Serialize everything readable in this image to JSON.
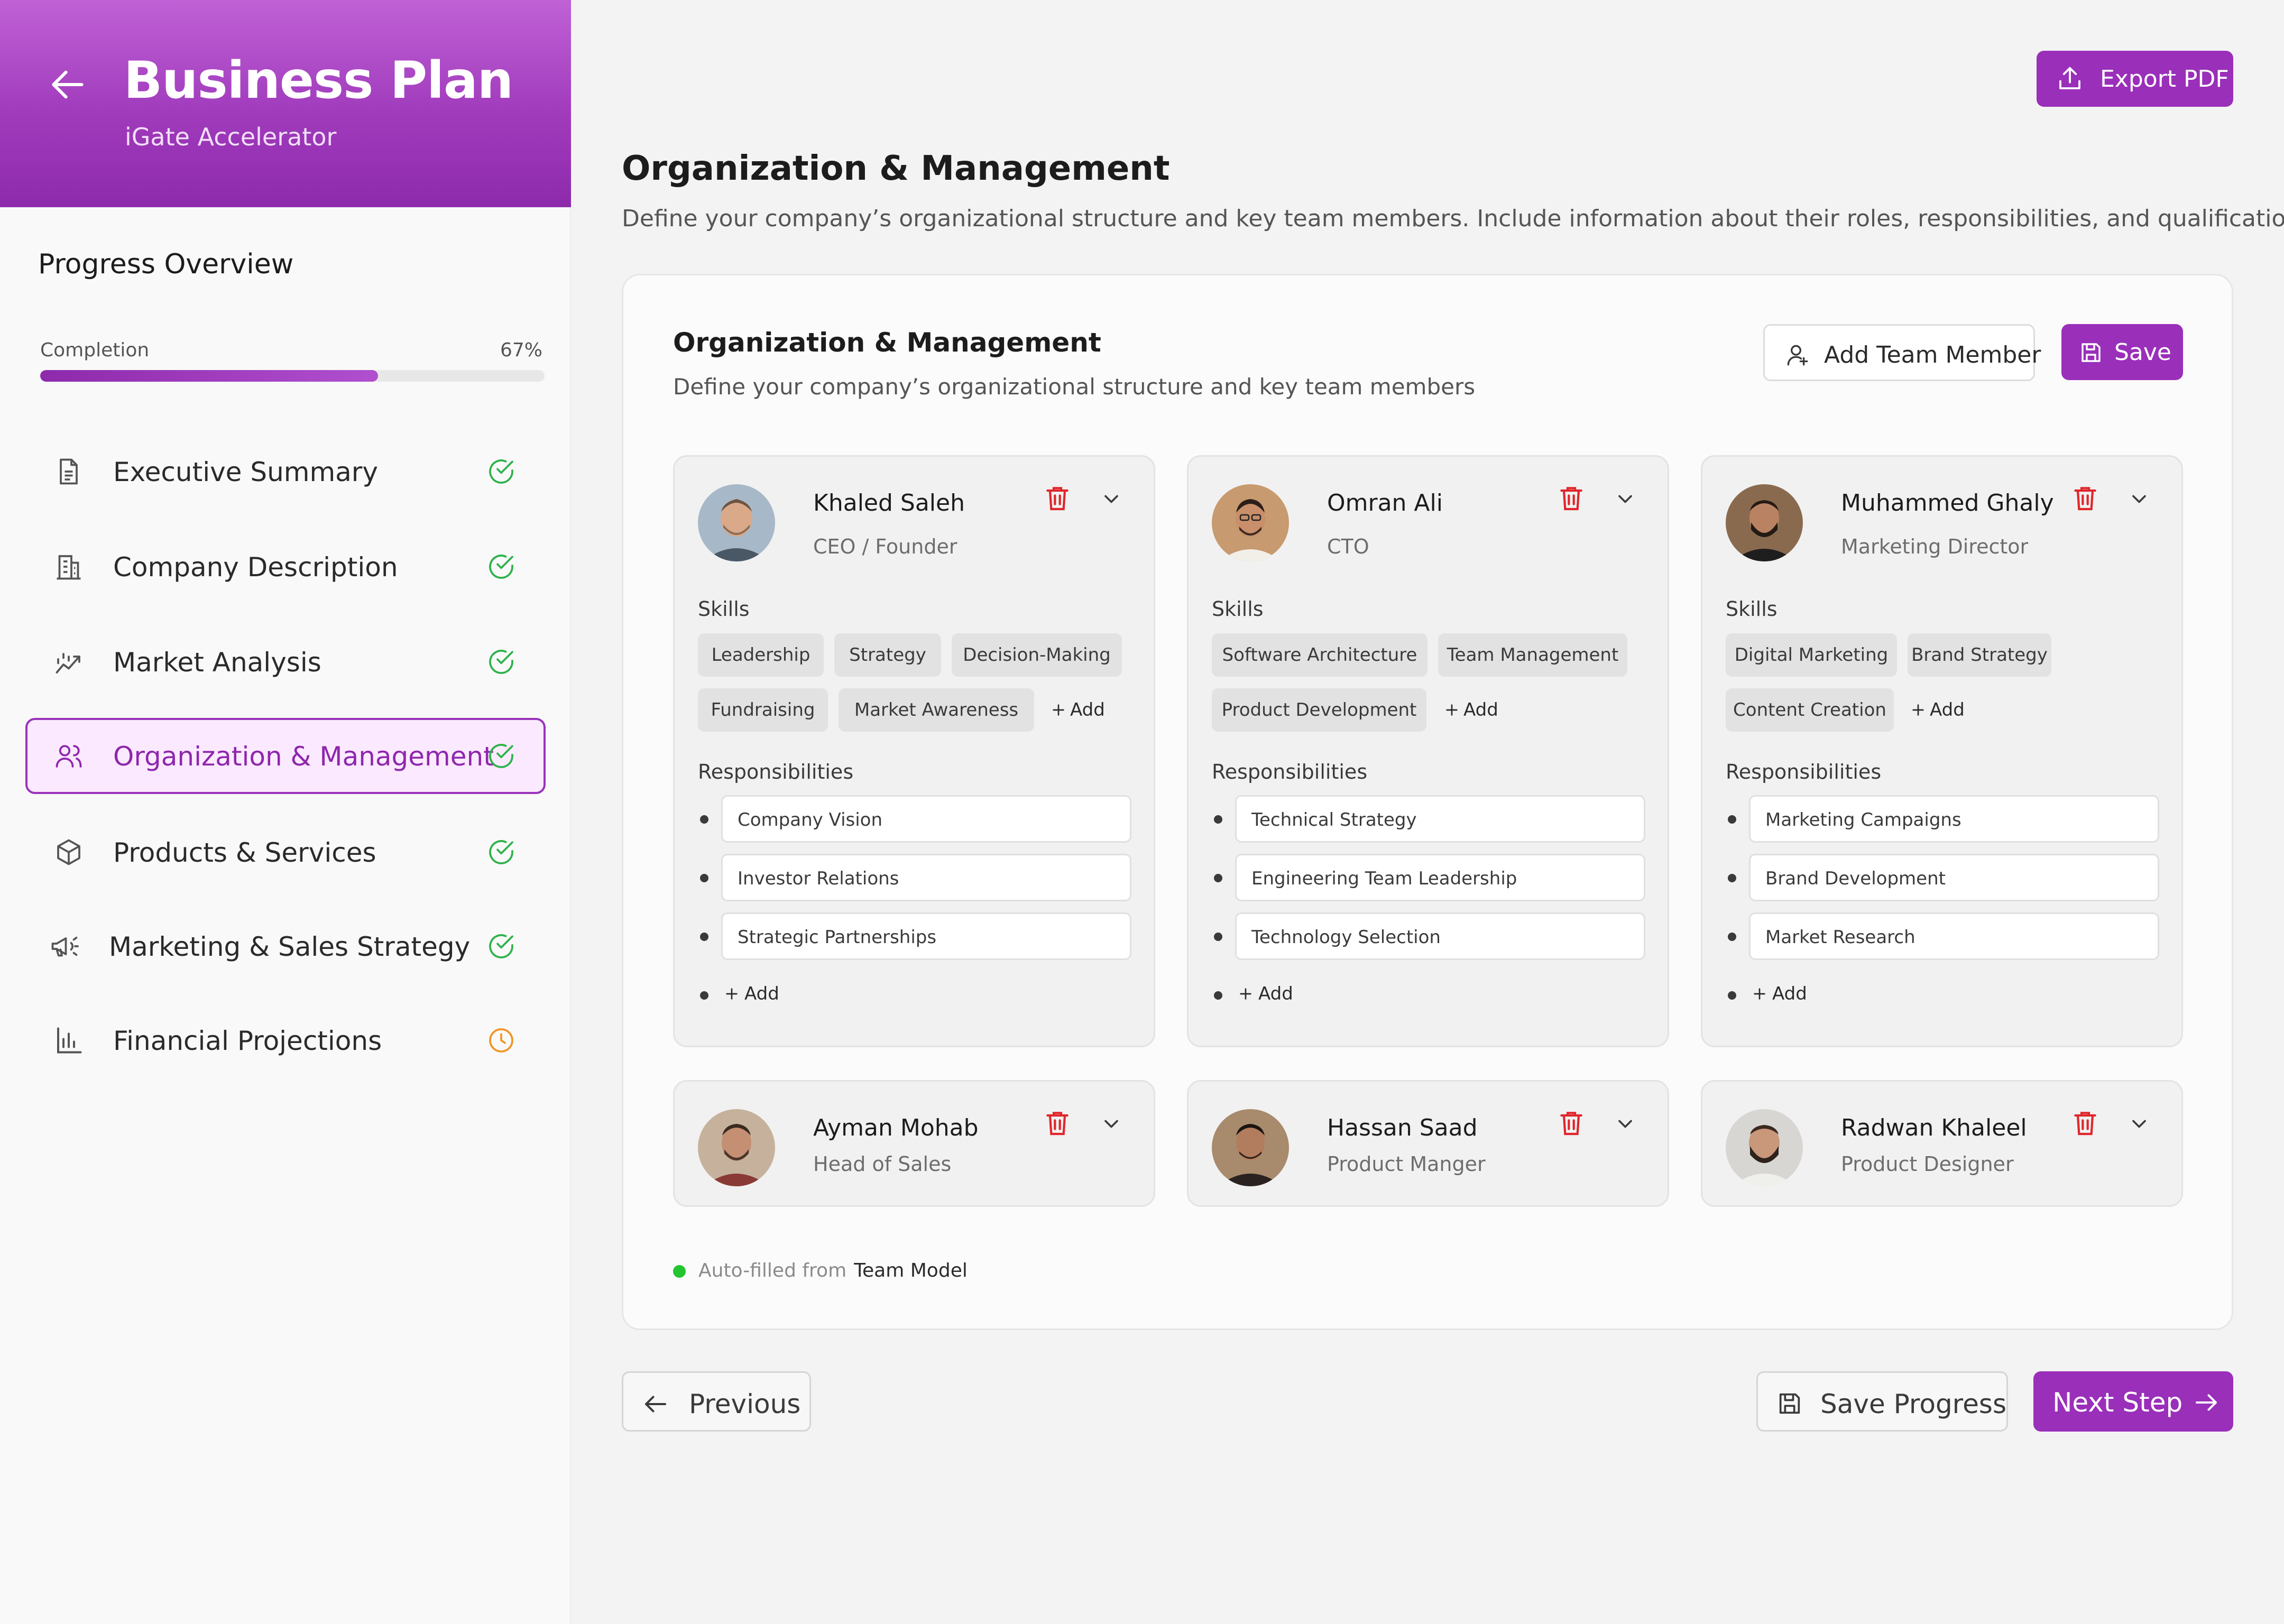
{
  "app": {
    "title": "Business Plan",
    "subtitle": "iGate Accelerator"
  },
  "sidebar": {
    "progress_title": "Progress Overview",
    "completion_label": "Completion",
    "completion_value": "67%",
    "completion_fraction": 0.67,
    "items": [
      {
        "label": "Executive Summary",
        "icon": "document-icon",
        "status": "complete"
      },
      {
        "label": "Company Description",
        "icon": "building-icon",
        "status": "complete"
      },
      {
        "label": "Market Analysis",
        "icon": "chart-trend-icon",
        "status": "complete"
      },
      {
        "label": "Organization & Management",
        "icon": "users-icon",
        "status": "complete",
        "active": true
      },
      {
        "label": "Products & Services",
        "icon": "box-icon",
        "status": "complete"
      },
      {
        "label": "Marketing & Sales Strategy",
        "icon": "megaphone-icon",
        "status": "complete"
      },
      {
        "label": "Financial Projections",
        "icon": "bar-chart-icon",
        "status": "in-progress"
      }
    ]
  },
  "toolbar": {
    "export_label": "Export PDF"
  },
  "page": {
    "title": "Organization & Management",
    "description": "Define your company’s organizational structure and key team members. Include information about their roles, responsibilities, and qualifications."
  },
  "card": {
    "title": "Organization & Management",
    "description": "Define your company’s organizational structure and key team members",
    "add_member_label": "Add Team Member",
    "save_label": "Save",
    "skills_label": "Skills",
    "responsibilities_label": "Responsibilities",
    "add_label": "Add",
    "members": [
      {
        "name": "Khaled Saleh",
        "role": "CEO / Founder",
        "expanded": true,
        "skills": [
          "Leadership",
          "Strategy",
          "Decision-Making",
          "Fundraising",
          "Market Awareness"
        ],
        "responsibilities": [
          "Company Vision",
          "Investor Relations",
          "Strategic Partnerships"
        ]
      },
      {
        "name": "Omran Ali",
        "role": "CTO",
        "expanded": true,
        "skills": [
          "Software Architecture",
          "Team Management",
          "Product Development"
        ],
        "responsibilities": [
          "Technical Strategy",
          "Engineering Team Leadership",
          "Technology Selection"
        ]
      },
      {
        "name": "Muhammed Ghaly",
        "role": "Marketing Director",
        "expanded": true,
        "skills": [
          "Digital Marketing",
          "Brand Strategy",
          "Content Creation"
        ],
        "responsibilities": [
          "Marketing Campaigns",
          "Brand Development",
          "Market Research"
        ]
      },
      {
        "name": "Ayman Mohab",
        "role": "Head of Sales",
        "expanded": false
      },
      {
        "name": "Hassan Saad",
        "role": "Product Manger",
        "expanded": false
      },
      {
        "name": "Radwan Khaleel",
        "role": "Product Designer",
        "expanded": false
      }
    ],
    "autofill_prefix": "Auto-filled from",
    "autofill_source": "Team Model"
  },
  "footer": {
    "previous_label": "Previous",
    "save_progress_label": "Save Progress",
    "next_label": "Next Step"
  },
  "colors": {
    "accent": "#9a2fba",
    "accent_light": "#fbeaff",
    "success": "#2fb24a",
    "warning": "#f0952a",
    "danger": "#e0262b",
    "autofill_dot": "#22c430"
  }
}
